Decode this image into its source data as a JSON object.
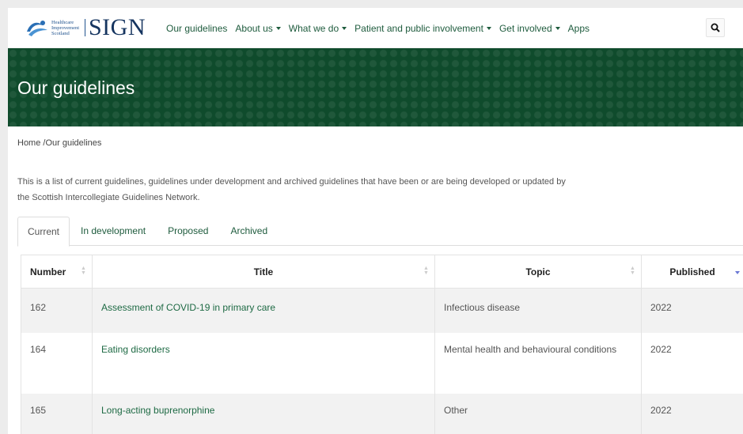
{
  "brand": {
    "his_lines": [
      "Healthcare",
      "Improvement",
      "Scotland"
    ],
    "sign": "SIGN"
  },
  "nav": {
    "items": [
      {
        "label": "Our guidelines",
        "dropdown": false
      },
      {
        "label": "About us",
        "dropdown": true
      },
      {
        "label": "What we do",
        "dropdown": true
      },
      {
        "label": "Patient and public involvement",
        "dropdown": true
      },
      {
        "label": "Get involved",
        "dropdown": true
      },
      {
        "label": "Apps",
        "dropdown": false
      }
    ],
    "search_icon": "search-icon"
  },
  "banner": {
    "title": "Our guidelines"
  },
  "breadcrumb": "Home /Our guidelines",
  "intro": "This is a list of current guidelines, guidelines under development and archived guidelines that have been or are being developed or updated by the Scottish Intercollegiate Guidelines Network.",
  "tabs": [
    "Current",
    "In development",
    "Proposed",
    "Archived"
  ],
  "active_tab": "Current",
  "table": {
    "headers": [
      "Number",
      "Title",
      "Topic",
      "Published"
    ],
    "rows": [
      {
        "number": "162",
        "title": "Assessment of COVID-19 in primary care",
        "topic": "Infectious disease",
        "published": "2022"
      },
      {
        "number": "164",
        "title": "Eating disorders",
        "topic": "Mental health and behavioural conditions",
        "published": "2022"
      },
      {
        "number": "165",
        "title": "Long-acting buprenorphine",
        "topic": "Other",
        "published": "2022"
      }
    ]
  },
  "colors": {
    "banner": "#0f4b2c",
    "link": "#1e5b3d",
    "brand_blue": "#15345f",
    "stripe": "#f2f2f2"
  }
}
